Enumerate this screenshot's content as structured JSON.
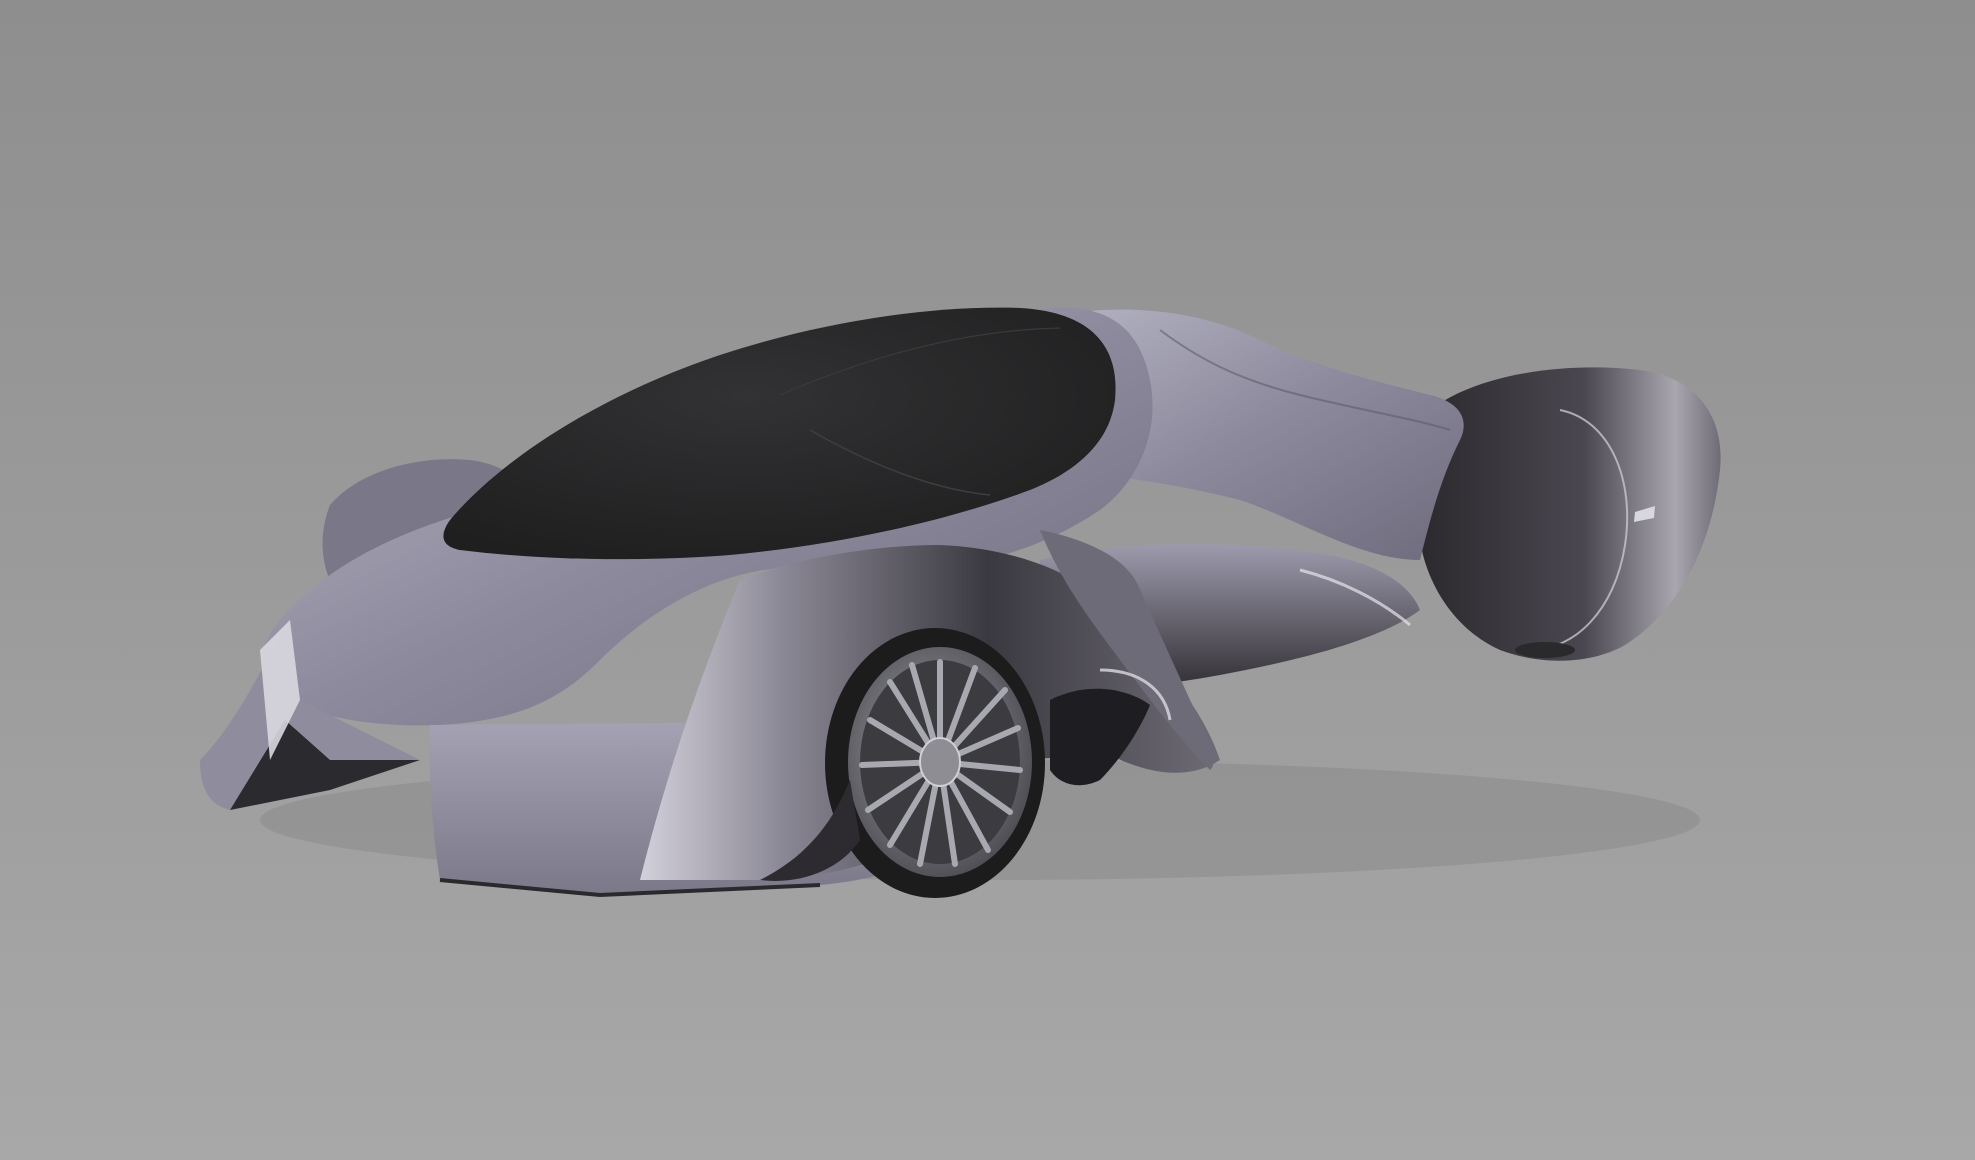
{
  "scene": {
    "subject": "car-render-hypercar",
    "colors": {
      "background_top": "#8f8f8f",
      "background_bottom": "#a7a7a7",
      "body_light": "#b4b3c2",
      "body_mid": "#7f7d8f",
      "body_dark": "#2e2c30",
      "canopy": "#262627",
      "tire": "#1e1e1f",
      "rim": "#8c8c92",
      "rim_dark": "#3a3a3e"
    }
  }
}
